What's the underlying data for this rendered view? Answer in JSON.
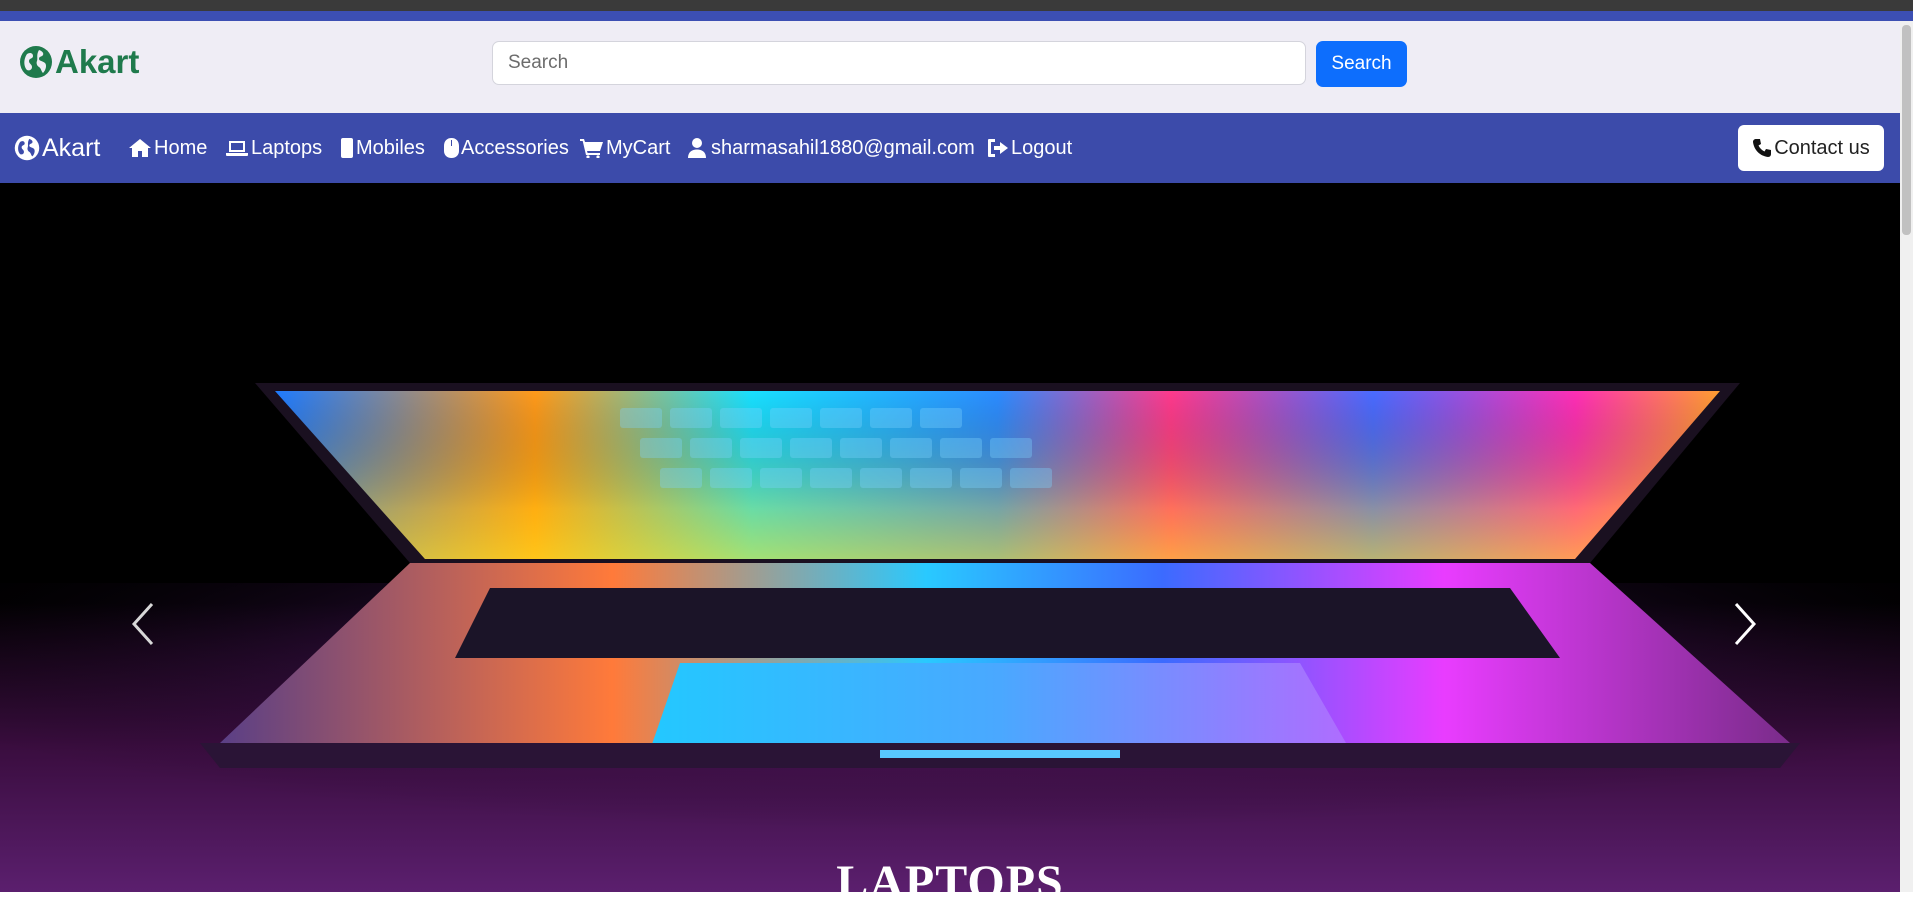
{
  "header": {
    "brand": "Akart",
    "search": {
      "placeholder": "Search",
      "value": ""
    },
    "search_button": "Search"
  },
  "navbar": {
    "brand": "Akart",
    "items": [
      {
        "label": "Home",
        "icon": "home-icon"
      },
      {
        "label": "Laptops",
        "icon": "laptop-icon"
      },
      {
        "label": "Mobiles",
        "icon": "mobile-icon"
      },
      {
        "label": "Accessories",
        "icon": "mouse-icon"
      },
      {
        "label": "MyCart",
        "icon": "cart-icon"
      },
      {
        "label": "sharmasahil1880@gmail.com",
        "icon": "user-icon"
      },
      {
        "label": "Logout",
        "icon": "logout-icon"
      }
    ],
    "contact": {
      "label": "Contact us",
      "icon": "phone-icon"
    }
  },
  "hero": {
    "caption": "LAPTOPS",
    "prev_icon": "chevron-left-icon",
    "next_icon": "chevron-right-icon"
  },
  "colors": {
    "top_strip": "#3a3a3a",
    "header_bg": "#efedf5",
    "brand_green": "#1f7a4c",
    "navbar_bg": "#3c4baa",
    "search_button": "#0d6efd"
  }
}
